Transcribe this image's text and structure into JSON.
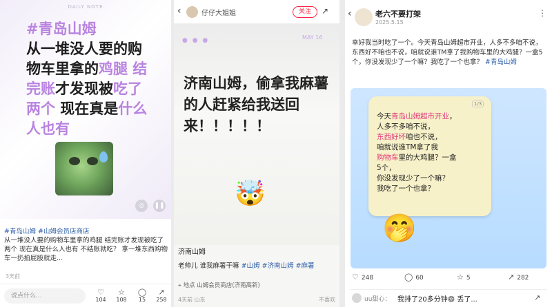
{
  "panel1": {
    "brand": "DAILY NOTE",
    "hero_lines": [
      {
        "segs": [
          {
            "t": "#青岛山姆",
            "c": "hl"
          }
        ]
      },
      {
        "segs": [
          {
            "t": "从一堆没人要的购",
            "c": ""
          }
        ]
      },
      {
        "segs": [
          {
            "t": "物车里拿的",
            "c": ""
          },
          {
            "t": "鸡腿 结",
            "c": "hl"
          }
        ]
      },
      {
        "segs": [
          {
            "t": "完账",
            "c": "hl"
          },
          {
            "t": "才发现被",
            "c": ""
          },
          {
            "t": "吃了",
            "c": "hl"
          }
        ]
      },
      {
        "segs": [
          {
            "t": "两个",
            "c": "hl"
          },
          {
            "t": " 现在真是",
            "c": ""
          },
          {
            "t": "什么",
            "c": "hl"
          }
        ]
      },
      {
        "segs": [
          {
            "t": "人也有",
            "c": "hl"
          }
        ]
      }
    ],
    "tags": "#青岛山姆 #山姆会员店商店",
    "body": "从一堆没人要的购物车里拿的鸡腿 结完账才发现被吃了两个 现在真是什么人也有 不结账就吃？ 拿一堆东西购物车一扔拍屁股就走...",
    "time": "3天前",
    "comment_placeholder": "说点什么...",
    "stats": [
      {
        "icon": "heart-icon",
        "glyph": "♡",
        "value": "104"
      },
      {
        "icon": "star-icon",
        "glyph": "☆",
        "value": "108"
      },
      {
        "icon": "comment-icon",
        "glyph": "◯",
        "value": "15"
      },
      {
        "icon": "share-icon",
        "glyph": "↗",
        "value": "258"
      }
    ]
  },
  "panel2": {
    "username": "仔仔大姐姐",
    "follow": "关注",
    "date": "MAY 16",
    "dots": "● ● ●",
    "title": "济南山姆，偷拿我麻薯的人赶紧给我送回来！！！！！",
    "emoji": "🤯",
    "caption_title": "济南山姆",
    "caption_desc": "老帅儿 谁我麻薯干嘛",
    "caption_tags": "#山姆 #济南山姆 #麻薯",
    "location": "地点  山姆会员商店(济南高新)",
    "footer": "4天前 山东",
    "report": "不喜欢"
  },
  "panel3": {
    "name": "老六不要打架",
    "date": "2025.5.15",
    "text_pre": "幸好我当时吃了一个。今天青岛山姆超市开业，人多不多咱不说，东西好不咱也不说，咱就说谁TM拿了我购物车里的大鸡腿？一盒5个，你没发现少了一个嘛？我吃了一个也拿？ ",
    "text_tag": "#青岛山姆",
    "page_indicator": "1/3",
    "note_lines": [
      {
        "segs": [
          {
            "t": "今天",
            "c": ""
          },
          {
            "t": "青岛山姆超市开业",
            "c": "r"
          },
          {
            "t": "，",
            "c": ""
          }
        ]
      },
      {
        "segs": [
          {
            "t": "人多不多咱不说，",
            "c": ""
          }
        ]
      },
      {
        "segs": [
          {
            "t": "东西好坏",
            "c": "r"
          },
          {
            "t": "咱也不说，",
            "c": ""
          }
        ]
      },
      {
        "segs": [
          {
            "t": "咱就说谁TM拿了我",
            "c": ""
          }
        ]
      },
      {
        "segs": [
          {
            "t": "购物车",
            "c": "r"
          },
          {
            "t": "里的大鸡腿？一盒",
            "c": ""
          }
        ]
      },
      {
        "segs": [
          {
            "t": "5个，",
            "c": ""
          }
        ]
      },
      {
        "segs": [
          {
            "t": "你没发现少了一个嘛？",
            "c": ""
          }
        ]
      },
      {
        "segs": [
          {
            "t": "我吃了一个也拿？",
            "c": ""
          }
        ]
      }
    ],
    "face": "🤭",
    "stats": [
      {
        "icon": "heart-icon",
        "glyph": "♡",
        "value": "248"
      },
      {
        "icon": "comment-icon",
        "glyph": "◯",
        "value": "60"
      },
      {
        "icon": "star-icon",
        "glyph": "☆",
        "value": "5"
      },
      {
        "icon": "share-icon",
        "glyph": "↗",
        "value": "282"
      }
    ],
    "comment_user": "uu甜心：",
    "comment_text": "我排了20多分钟😄 丢了..."
  }
}
